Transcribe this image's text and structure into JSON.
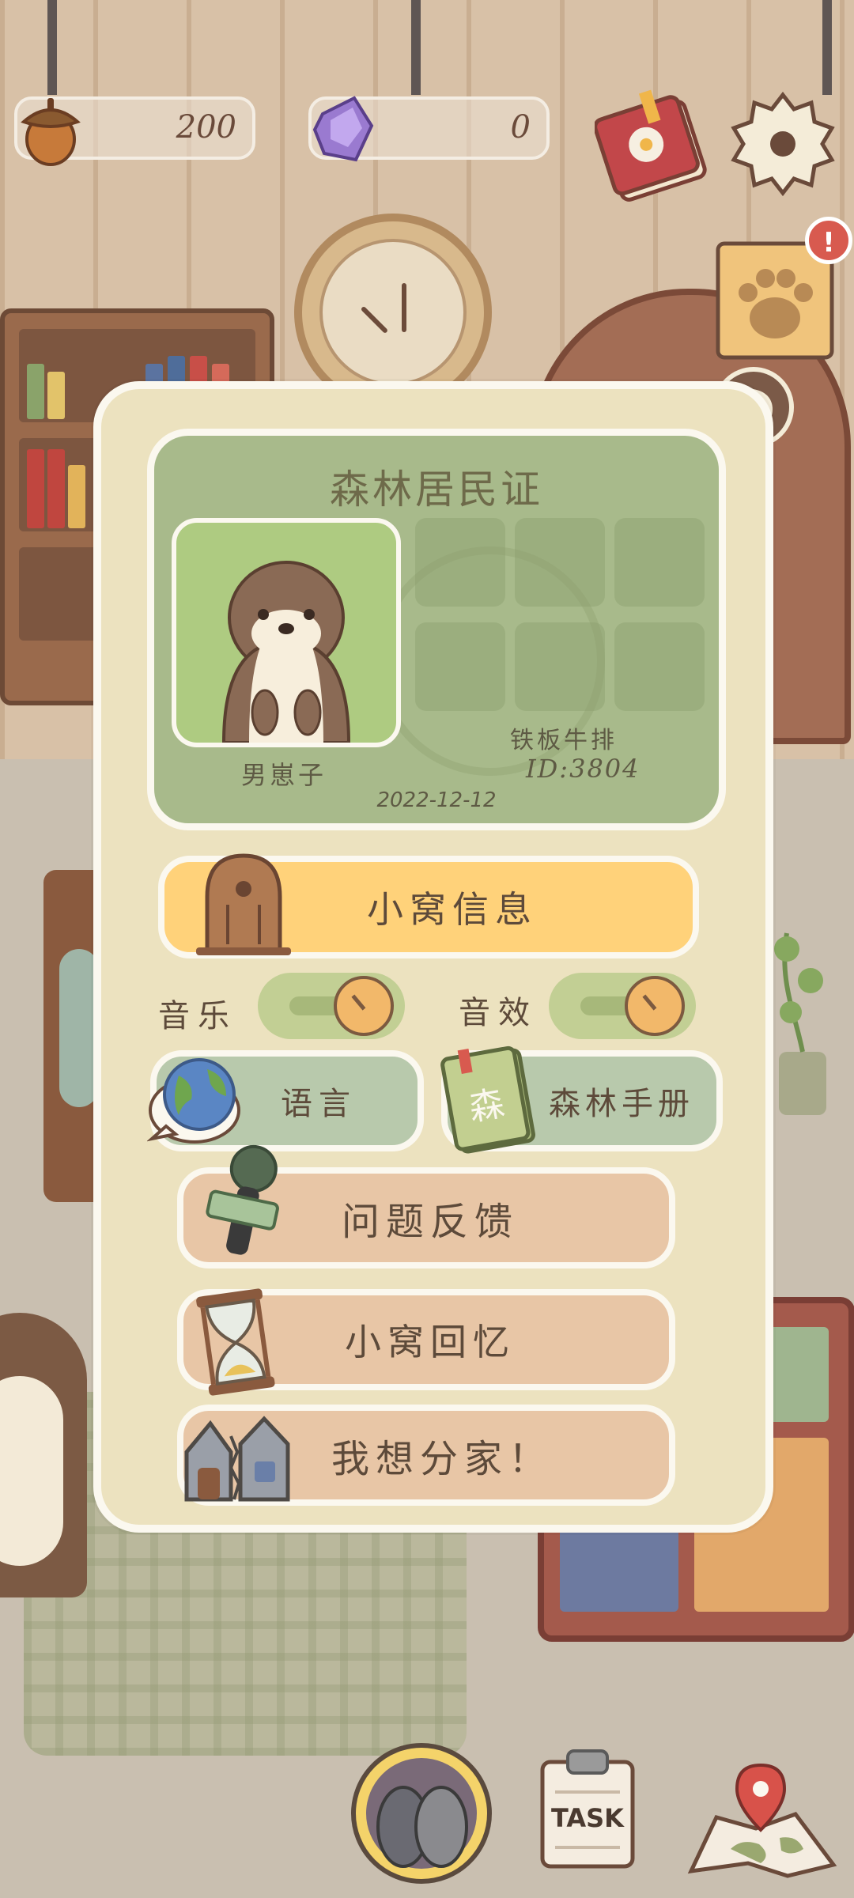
{
  "hud": {
    "acorn_count": "200",
    "gem_count": "0",
    "journal_icon": "journal-book-icon",
    "settings_icon": "gear-icon",
    "paw_note_icon": "paw-note-icon",
    "paw_note_badge": "!",
    "return_icon": "return-arrow-icon"
  },
  "id_card": {
    "title": "森林居民证",
    "pet_name": "男崽子",
    "owner_name": "铁板牛排",
    "id": "ID:3804",
    "date": "2022-12-12"
  },
  "menu": {
    "nest_info": "小窝信息",
    "music_label": "音乐",
    "sound_label": "音效",
    "music_on": true,
    "sound_on": true,
    "language": "语言",
    "forest_manual": "森林手册",
    "manual_cover": "森",
    "feedback": "问题反馈",
    "nest_memory": "小窝回忆",
    "leave_home": "我想分家！"
  },
  "bottom": {
    "task_label": "TASK",
    "otter_icon": "otter-friends-icon",
    "map_icon": "map-pin-icon"
  },
  "colors": {
    "panel": "#ece2bf",
    "card": "#a8ba8b",
    "nest_button": "#ffd27a",
    "blue_button": "#b8c9ac",
    "peach_button": "#e8c6a6"
  }
}
